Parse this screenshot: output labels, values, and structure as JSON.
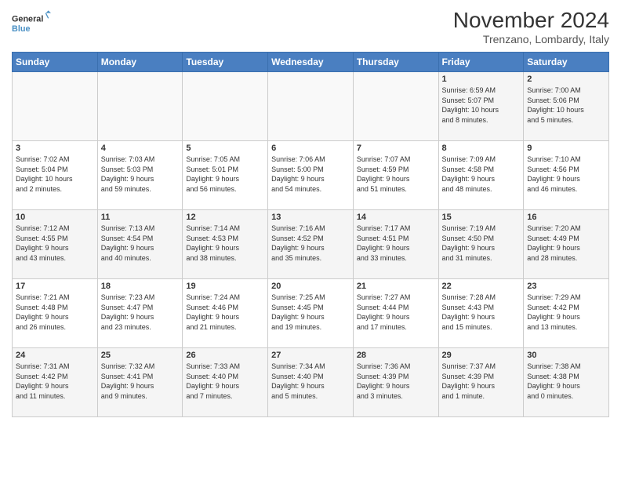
{
  "header": {
    "logo_line1": "General",
    "logo_line2": "Blue",
    "month_title": "November 2024",
    "subtitle": "Trenzano, Lombardy, Italy"
  },
  "days_of_week": [
    "Sunday",
    "Monday",
    "Tuesday",
    "Wednesday",
    "Thursday",
    "Friday",
    "Saturday"
  ],
  "weeks": [
    [
      {
        "day": "",
        "info": ""
      },
      {
        "day": "",
        "info": ""
      },
      {
        "day": "",
        "info": ""
      },
      {
        "day": "",
        "info": ""
      },
      {
        "day": "",
        "info": ""
      },
      {
        "day": "1",
        "info": "Sunrise: 6:59 AM\nSunset: 5:07 PM\nDaylight: 10 hours\nand 8 minutes."
      },
      {
        "day": "2",
        "info": "Sunrise: 7:00 AM\nSunset: 5:06 PM\nDaylight: 10 hours\nand 5 minutes."
      }
    ],
    [
      {
        "day": "3",
        "info": "Sunrise: 7:02 AM\nSunset: 5:04 PM\nDaylight: 10 hours\nand 2 minutes."
      },
      {
        "day": "4",
        "info": "Sunrise: 7:03 AM\nSunset: 5:03 PM\nDaylight: 9 hours\nand 59 minutes."
      },
      {
        "day": "5",
        "info": "Sunrise: 7:05 AM\nSunset: 5:01 PM\nDaylight: 9 hours\nand 56 minutes."
      },
      {
        "day": "6",
        "info": "Sunrise: 7:06 AM\nSunset: 5:00 PM\nDaylight: 9 hours\nand 54 minutes."
      },
      {
        "day": "7",
        "info": "Sunrise: 7:07 AM\nSunset: 4:59 PM\nDaylight: 9 hours\nand 51 minutes."
      },
      {
        "day": "8",
        "info": "Sunrise: 7:09 AM\nSunset: 4:58 PM\nDaylight: 9 hours\nand 48 minutes."
      },
      {
        "day": "9",
        "info": "Sunrise: 7:10 AM\nSunset: 4:56 PM\nDaylight: 9 hours\nand 46 minutes."
      }
    ],
    [
      {
        "day": "10",
        "info": "Sunrise: 7:12 AM\nSunset: 4:55 PM\nDaylight: 9 hours\nand 43 minutes."
      },
      {
        "day": "11",
        "info": "Sunrise: 7:13 AM\nSunset: 4:54 PM\nDaylight: 9 hours\nand 40 minutes."
      },
      {
        "day": "12",
        "info": "Sunrise: 7:14 AM\nSunset: 4:53 PM\nDaylight: 9 hours\nand 38 minutes."
      },
      {
        "day": "13",
        "info": "Sunrise: 7:16 AM\nSunset: 4:52 PM\nDaylight: 9 hours\nand 35 minutes."
      },
      {
        "day": "14",
        "info": "Sunrise: 7:17 AM\nSunset: 4:51 PM\nDaylight: 9 hours\nand 33 minutes."
      },
      {
        "day": "15",
        "info": "Sunrise: 7:19 AM\nSunset: 4:50 PM\nDaylight: 9 hours\nand 31 minutes."
      },
      {
        "day": "16",
        "info": "Sunrise: 7:20 AM\nSunset: 4:49 PM\nDaylight: 9 hours\nand 28 minutes."
      }
    ],
    [
      {
        "day": "17",
        "info": "Sunrise: 7:21 AM\nSunset: 4:48 PM\nDaylight: 9 hours\nand 26 minutes."
      },
      {
        "day": "18",
        "info": "Sunrise: 7:23 AM\nSunset: 4:47 PM\nDaylight: 9 hours\nand 23 minutes."
      },
      {
        "day": "19",
        "info": "Sunrise: 7:24 AM\nSunset: 4:46 PM\nDaylight: 9 hours\nand 21 minutes."
      },
      {
        "day": "20",
        "info": "Sunrise: 7:25 AM\nSunset: 4:45 PM\nDaylight: 9 hours\nand 19 minutes."
      },
      {
        "day": "21",
        "info": "Sunrise: 7:27 AM\nSunset: 4:44 PM\nDaylight: 9 hours\nand 17 minutes."
      },
      {
        "day": "22",
        "info": "Sunrise: 7:28 AM\nSunset: 4:43 PM\nDaylight: 9 hours\nand 15 minutes."
      },
      {
        "day": "23",
        "info": "Sunrise: 7:29 AM\nSunset: 4:42 PM\nDaylight: 9 hours\nand 13 minutes."
      }
    ],
    [
      {
        "day": "24",
        "info": "Sunrise: 7:31 AM\nSunset: 4:42 PM\nDaylight: 9 hours\nand 11 minutes."
      },
      {
        "day": "25",
        "info": "Sunrise: 7:32 AM\nSunset: 4:41 PM\nDaylight: 9 hours\nand 9 minutes."
      },
      {
        "day": "26",
        "info": "Sunrise: 7:33 AM\nSunset: 4:40 PM\nDaylight: 9 hours\nand 7 minutes."
      },
      {
        "day": "27",
        "info": "Sunrise: 7:34 AM\nSunset: 4:40 PM\nDaylight: 9 hours\nand 5 minutes."
      },
      {
        "day": "28",
        "info": "Sunrise: 7:36 AM\nSunset: 4:39 PM\nDaylight: 9 hours\nand 3 minutes."
      },
      {
        "day": "29",
        "info": "Sunrise: 7:37 AM\nSunset: 4:39 PM\nDaylight: 9 hours\nand 1 minute."
      },
      {
        "day": "30",
        "info": "Sunrise: 7:38 AM\nSunset: 4:38 PM\nDaylight: 9 hours\nand 0 minutes."
      }
    ]
  ]
}
